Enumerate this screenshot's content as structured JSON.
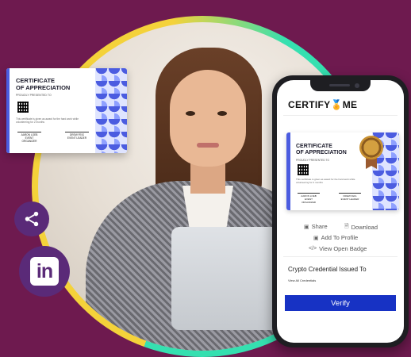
{
  "app": {
    "brand": "CERTIFY",
    "brand_suffix": "ME",
    "brand_medal_icon": "medal-icon"
  },
  "certificate": {
    "title_line1": "CERTIFICATE",
    "title_line2": "OF APPRECIATION",
    "presented": "PROUDLY PRESENTED TO",
    "body": "This certificate is given as award for the hard work while volunteering for 2 months",
    "signer1_name": "AARON LOEB",
    "signer1_role": "EVENT ORGANIZER",
    "signer2_name": "DREW FEIG",
    "signer2_role": "EVENT LEADER"
  },
  "actions": {
    "share": "Share",
    "download": "Download",
    "add_to_profile": "Add To Profile",
    "view_open_badge": "View Open Badge"
  },
  "credential": {
    "issued_to": "Crypto Credential Issued To",
    "view_all": "View All Credentials"
  },
  "verify_button": "Verify",
  "social": {
    "linkedin_label": "in"
  },
  "colors": {
    "background": "#6e1a4f",
    "accent_blue": "#1732c4",
    "ring_green": "#35e0b0",
    "ring_yellow": "#f4d23a",
    "social_purple": "#5a2a78"
  }
}
